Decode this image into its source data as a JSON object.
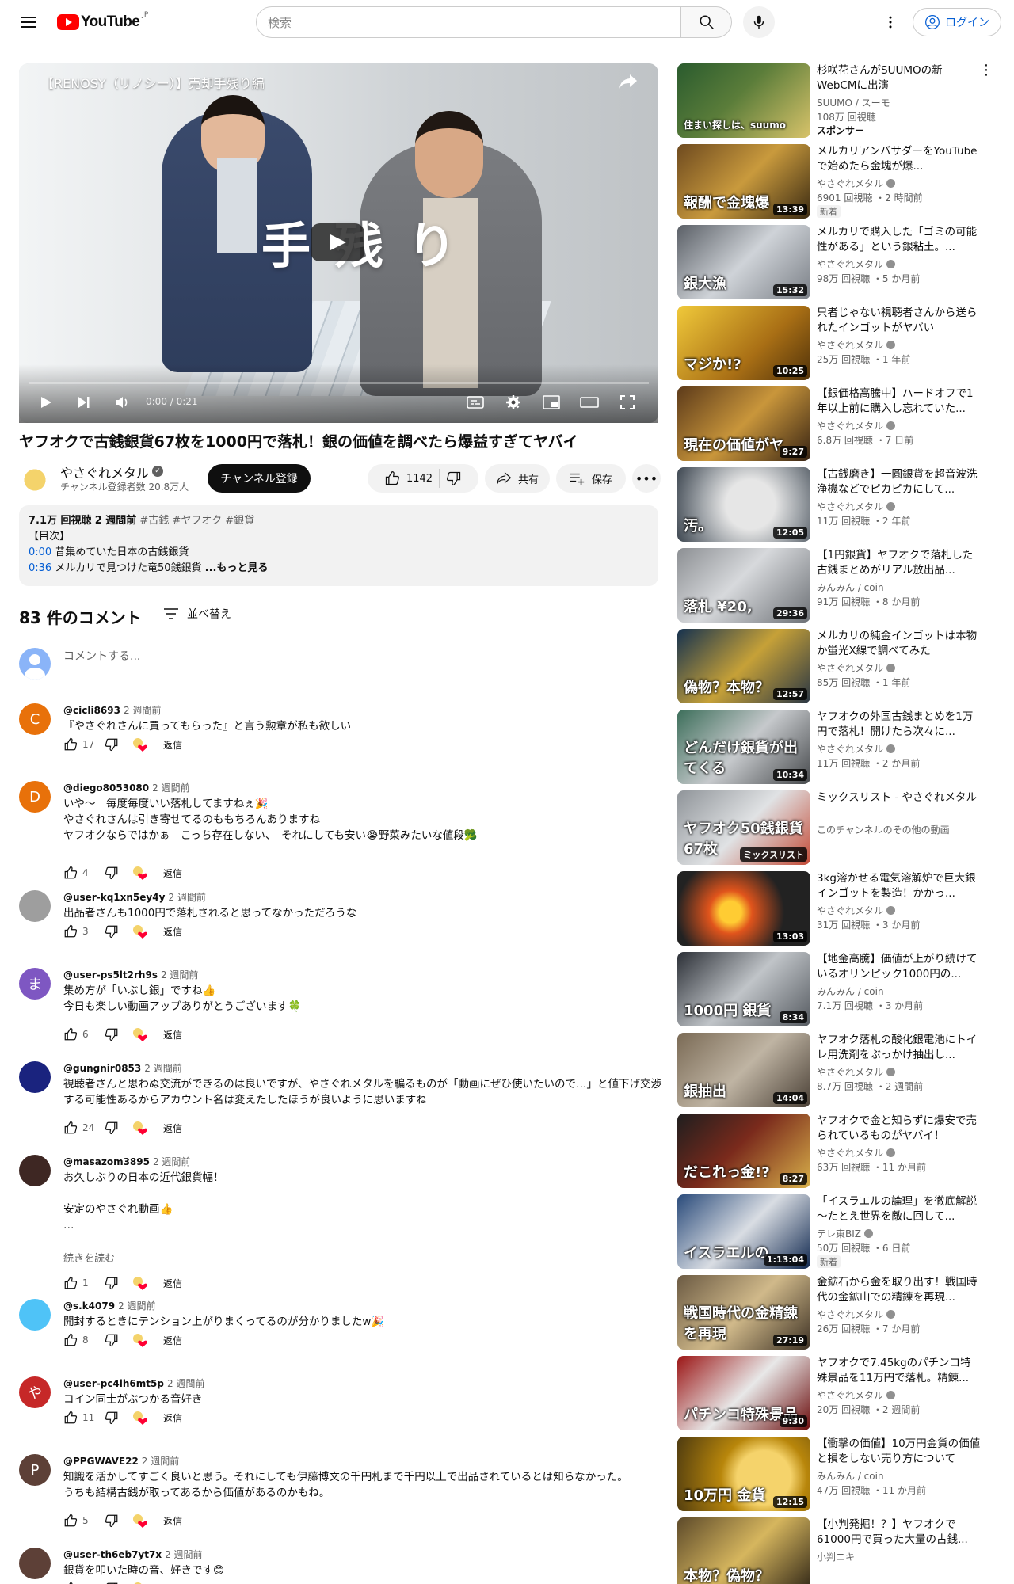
{
  "header": {
    "logo_text": "YouTube",
    "logo_region": "JP",
    "search_placeholder": "検索",
    "signin_label": "ログイン"
  },
  "player": {
    "overlay_title": "【RENOSY（リノシー）】売却手残り編",
    "overlay_caption": "手残り",
    "time": "0:00 / 0:21"
  },
  "video": {
    "title": "ヤフオクで古銭銀貨67枚を1000円で落札！銀の価値を調べたら爆益すぎてヤバイ",
    "channel": "やさぐれメタル",
    "subscribers": "チャンネル登録者数 20.8万人",
    "subscribe_label": "チャンネル登録",
    "likes": "1142",
    "share_label": "共有",
    "save_label": "保存"
  },
  "description": {
    "views": "7.1万 回視聴",
    "date": "2 週間前",
    "tags": "#古銭 #ヤフオク #銀貨",
    "heading": "【目次】",
    "chapters": [
      {
        "time": "0:00",
        "text": "昔集めていた日本の古銭銀貨"
      },
      {
        "time": "0:36",
        "text": "メルカリで見つけた竜50銭銀貨"
      }
    ],
    "more": "...もっと見る"
  },
  "comments_section": {
    "count": "83 件のコメント",
    "sort_label": "並べ替え",
    "placeholder": "コメントする...",
    "reply_label": "返信",
    "read_more": "続きを読む"
  },
  "comments": [
    {
      "author": "@cicli8693",
      "time": "2 週間前",
      "text": "『やさぐれさんに買ってもらった』と言う勲章が私も欲しい",
      "likes": "17",
      "avatar_letter": "C",
      "avatar_color": "#e8710a"
    },
    {
      "author": "@diego8053080",
      "time": "2 週間前",
      "text": "いや〜　毎度毎度いい落札してますねぇ🎉\nやさぐれさんは引き寄せてるのももちろんありますね\nヤフオクならではかぁ　こっち存在しない、　それにしても安い😭野菜みたいな値段🥦",
      "likes": "4",
      "avatar_letter": "D",
      "avatar_color": "#e8710a"
    },
    {
      "author": "@user-kq1xn5ey4y",
      "time": "2 週間前",
      "text": "出品者さんも1000円で落札されると思ってなかっただろうな",
      "likes": "3",
      "avatar_letter": "",
      "avatar_color": "#9e9e9e"
    },
    {
      "author": "@user-ps5lt2rh9s",
      "time": "2 週間前",
      "text": "集め方が「いぶし銀」ですね👍\n今日も楽しい動画アップありがとうございます🍀",
      "likes": "6",
      "avatar_letter": "ま",
      "avatar_color": "#7e57c2"
    },
    {
      "author": "@gungnir0853",
      "time": "2 週間前",
      "text": "視聴者さんと思わぬ交流ができるのは良いですが、やさぐれメタルを騙るものが「動画にぜひ使いたいので…」と値下げ交渉する可能性あるからアカウント名は変えたしたほうが良いように思いますね",
      "likes": "24",
      "avatar_letter": "",
      "avatar_color": "#1a237e"
    },
    {
      "author": "@masazom3895",
      "time": "2 週間前",
      "text": "お久しぶりの日本の近代銀貨幅！\n\n安定のやさぐれ動画👍\n…",
      "likes": "1",
      "avatar_letter": "",
      "avatar_color": "#3e2723"
    },
    {
      "author": "@s.k4079",
      "time": "2 週間前",
      "text": "開封するときにテンション上がりまくってるのが分かりましたw🎉",
      "likes": "8",
      "avatar_letter": "",
      "avatar_color": "#4fc3f7"
    },
    {
      "author": "@user-pc4lh6mt5p",
      "time": "2 週間前",
      "text": "コイン同士がぶつかる音好き",
      "likes": "11",
      "avatar_letter": "や",
      "avatar_color": "#c62828"
    },
    {
      "author": "@PPGWAVE22",
      "time": "2 週間前",
      "text": "知識を活かしてすごく良いと思う。それにしても伊藤博文の千円札まで千円以上で出品されているとは知らなかった。\nうちも結構古銭が取ってあるから価値があるのかもね。",
      "likes": "5",
      "avatar_letter": "P",
      "avatar_color": "#5d4037"
    },
    {
      "author": "@user-th6eb7yt7x",
      "time": "2 週間前",
      "text": "銀貨を叩いた時の音、好きです😊",
      "likes": "",
      "avatar_letter": "",
      "avatar_color": "#5d4037"
    }
  ],
  "recommendations": [
    {
      "title": "杉咲花さんがSUUMOの新WebCMに出演",
      "channel": "SUUMO / スーモ",
      "meta": "108万 回視聴",
      "badge": "",
      "sponsor": "スポンサー",
      "duration": "",
      "thumb_text": "住まい探しは、suumo",
      "verified": false
    },
    {
      "title": "メルカリアンバサダーをYouTubeで始めたら金塊が爆...",
      "channel": "やさぐれメタル",
      "meta": "6901 回視聴 ・2 時間前",
      "badge": "新着",
      "sponsor": "",
      "duration": "13:39",
      "thumb_text": "報酬で金塊爆",
      "verified": true
    },
    {
      "title": "メルカリで購入した「ゴミの可能性がある」という銀粘土。...",
      "channel": "やさぐれメタル",
      "meta": "98万 回視聴 ・5 か月前",
      "badge": "",
      "sponsor": "",
      "duration": "15:32",
      "thumb_text": "銀大漁",
      "verified": true
    },
    {
      "title": "只者じゃない視聴者さんから送られたインゴットがヤバい",
      "channel": "やさぐれメタル",
      "meta": "25万 回視聴 ・1 年前",
      "badge": "",
      "sponsor": "",
      "duration": "10:25",
      "thumb_text": "マジか!?",
      "verified": true
    },
    {
      "title": "【銀価格高騰中】ハードオフで1年以上前に購入し忘れていた...",
      "channel": "やさぐれメタル",
      "meta": "6.8万 回視聴 ・7 日前",
      "badge": "",
      "sponsor": "",
      "duration": "9:27",
      "thumb_text": "現在の価値がヤ",
      "verified": true
    },
    {
      "title": "【古銭磨き】一圓銀貨を超音波洗浄機などでピカピカにして...",
      "channel": "やさぐれメタル",
      "meta": "11万 回視聴 ・2 年前",
      "badge": "",
      "sponsor": "",
      "duration": "12:05",
      "thumb_text": "汚。",
      "verified": true
    },
    {
      "title": "【1円銀貨】ヤフオクで落札した古銭まとめがリアル放出品...",
      "channel": "みんみん / coin",
      "meta": "91万 回視聴 ・8 か月前",
      "badge": "",
      "sponsor": "",
      "duration": "29:36",
      "thumb_text": "落札 ¥20,",
      "verified": false
    },
    {
      "title": "メルカリの純金インゴットは本物か蛍光X線で調べてみた",
      "channel": "やさぐれメタル",
      "meta": "85万 回視聴 ・1 年前",
      "badge": "",
      "sponsor": "",
      "duration": "12:57",
      "thumb_text": "偽物？本物？",
      "verified": true
    },
    {
      "title": "ヤフオクの外国古銭まとめを1万円で落札！開けたら次々に...",
      "channel": "やさぐれメタル",
      "meta": "11万 回視聴 ・2 か月前",
      "badge": "",
      "sponsor": "",
      "duration": "10:34",
      "thumb_text": "どんだけ銀貨が出てくる",
      "verified": true
    },
    {
      "title": "ミックスリスト - やさぐれメタル",
      "channel": "このチャンネルのその他の動画",
      "meta": "",
      "badge": "",
      "sponsor": "",
      "duration": "ミックスリスト",
      "thumb_text": "ヤフオク50銭銀貨67枚",
      "verified": false
    },
    {
      "title": "3kg溶かせる電気溶解炉で巨大銀インゴットを製造！かかっ...",
      "channel": "やさぐれメタル",
      "meta": "31万 回視聴 ・3 か月前",
      "badge": "",
      "sponsor": "",
      "duration": "13:03",
      "thumb_text": "",
      "verified": true
    },
    {
      "title": "【地金高騰】価値が上がり続けているオリンピック1000円の...",
      "channel": "みんみん / coin",
      "meta": "7.1万 回視聴 ・3 か月前",
      "badge": "",
      "sponsor": "",
      "duration": "8:34",
      "thumb_text": "1000円 銀貨",
      "verified": false
    },
    {
      "title": "ヤフオク落札の酸化銀電池にトイレ用洗剤をぶっかけ抽出し...",
      "channel": "やさぐれメタル",
      "meta": "8.7万 回視聴 ・2 週間前",
      "badge": "",
      "sponsor": "",
      "duration": "14:04",
      "thumb_text": "銀抽出",
      "verified": true
    },
    {
      "title": "ヤフオクで金と知らずに爆安で売られているものがヤバイ！",
      "channel": "やさぐれメタル",
      "meta": "63万 回視聴 ・11 か月前",
      "badge": "",
      "sponsor": "",
      "duration": "8:27",
      "thumb_text": "だこれっ金!?",
      "verified": true
    },
    {
      "title": "「イスラエルの論理」を徹底解説～たとえ世界を敵に回して...",
      "channel": "テレ東BIZ",
      "meta": "50万 回視聴 ・6 日前",
      "badge": "新着",
      "sponsor": "",
      "duration": "1:13:04",
      "thumb_text": "イスラエルの",
      "verified": true
    },
    {
      "title": "金鉱石から金を取り出す！戦国時代の金鉱山での精錬を再現...",
      "channel": "やさぐれメタル",
      "meta": "26万 回視聴 ・7 か月前",
      "badge": "",
      "sponsor": "",
      "duration": "27:19",
      "thumb_text": "戦国時代の金精錬を再現",
      "verified": true
    },
    {
      "title": "ヤフオクで7.45kgのパチンコ特殊景品を11万円で落札。精錬...",
      "channel": "やさぐれメタル",
      "meta": "20万 回視聴 ・2 週間前",
      "badge": "",
      "sponsor": "",
      "duration": "9:30",
      "thumb_text": "パチンコ特殊景品",
      "verified": true
    },
    {
      "title": "【衝撃の価値】10万円金貨の価値と損をしない売り方について",
      "channel": "みんみん / coin",
      "meta": "47万 回視聴 ・11 か月前",
      "badge": "",
      "sponsor": "",
      "duration": "12:15",
      "thumb_text": "10万円 金貨",
      "verified": false
    },
    {
      "title": "【小判発掘！？】ヤフオクで61000円で買った大量の古銭...",
      "channel": "小判ニキ",
      "meta": "",
      "badge": "",
      "sponsor": "",
      "duration": "",
      "thumb_text": "本物？偽物？",
      "verified": false
    }
  ]
}
